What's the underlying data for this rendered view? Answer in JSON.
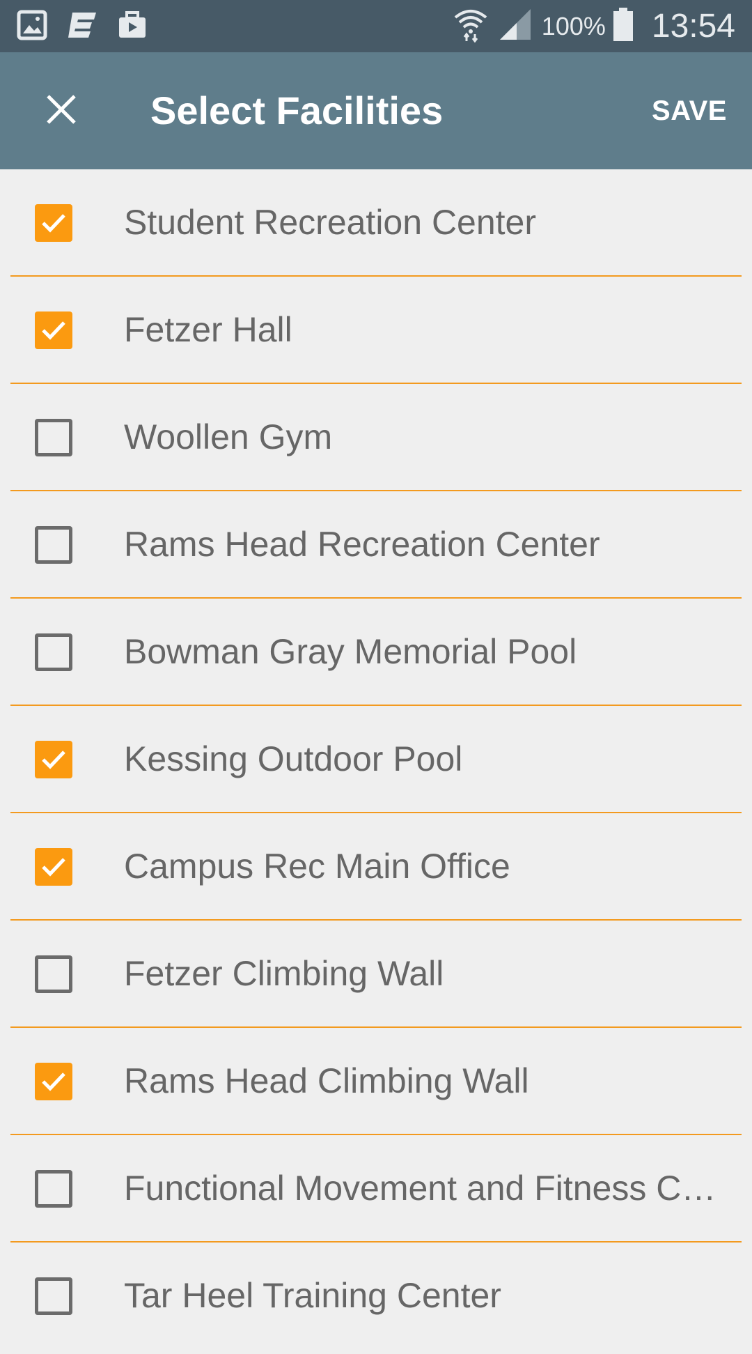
{
  "status_bar": {
    "icons_left": [
      "gallery-icon",
      "app-e-icon",
      "briefcase-icon"
    ],
    "icons_right": [
      "wifi-icon",
      "cell-signal-icon",
      "battery-icon"
    ],
    "battery_percent": "100%",
    "time": "13:54",
    "colors": {
      "background": "#475a67",
      "foreground": "#e6eaed"
    }
  },
  "app_bar": {
    "close_icon": "close-icon",
    "title": "Select Facilities",
    "save_label": "SAVE",
    "colors": {
      "background": "#5f7d8b",
      "text": "#ffffff"
    }
  },
  "accent_color": "#fb9a10",
  "divider_color": "#f39a1f",
  "facilities": [
    {
      "label": "Student Recreation Center",
      "checked": true
    },
    {
      "label": "Fetzer Hall",
      "checked": true
    },
    {
      "label": "Woollen Gym",
      "checked": false
    },
    {
      "label": "Rams Head Recreation Center",
      "checked": false
    },
    {
      "label": "Bowman Gray Memorial Pool",
      "checked": false
    },
    {
      "label": "Kessing Outdoor Pool",
      "checked": true
    },
    {
      "label": "Campus Rec Main Office",
      "checked": true
    },
    {
      "label": "Fetzer Climbing Wall",
      "checked": false
    },
    {
      "label": "Rams Head Climbing Wall",
      "checked": true
    },
    {
      "label": "Functional Movement and Fitness Center",
      "checked": false
    },
    {
      "label": "Tar Heel Training Center",
      "checked": false
    }
  ]
}
